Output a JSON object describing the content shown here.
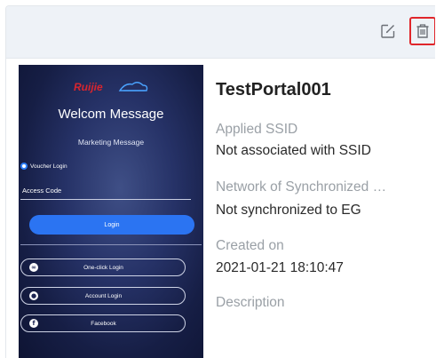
{
  "header": {
    "edit_icon": "edit-square-icon",
    "delete_icon": "trash-icon",
    "delete_highlight_color": "#e0262b"
  },
  "preview": {
    "brand": "Ruijie",
    "title": "Welcom Message",
    "marketing": "Marketing Message",
    "voucher_login": "Voucher Login",
    "access_code": "Access Code",
    "login_button": "Login",
    "options": [
      {
        "label": "One-click Login",
        "icon": "link-icon"
      },
      {
        "label": "Account Login",
        "icon": "user-icon"
      },
      {
        "label": "Facebook",
        "icon": "facebook-icon"
      }
    ],
    "accent_color": "#2b74f2"
  },
  "portal": {
    "name": "TestPortal001",
    "fields": [
      {
        "label": "Applied SSID",
        "value": "Not associated with SSID"
      },
      {
        "label": "Network of Synchronized …",
        "value": "Not synchronized to EG"
      },
      {
        "label": "Created on",
        "value": "2021-01-21 18:10:47"
      },
      {
        "label": "Description",
        "value": ""
      }
    ]
  }
}
